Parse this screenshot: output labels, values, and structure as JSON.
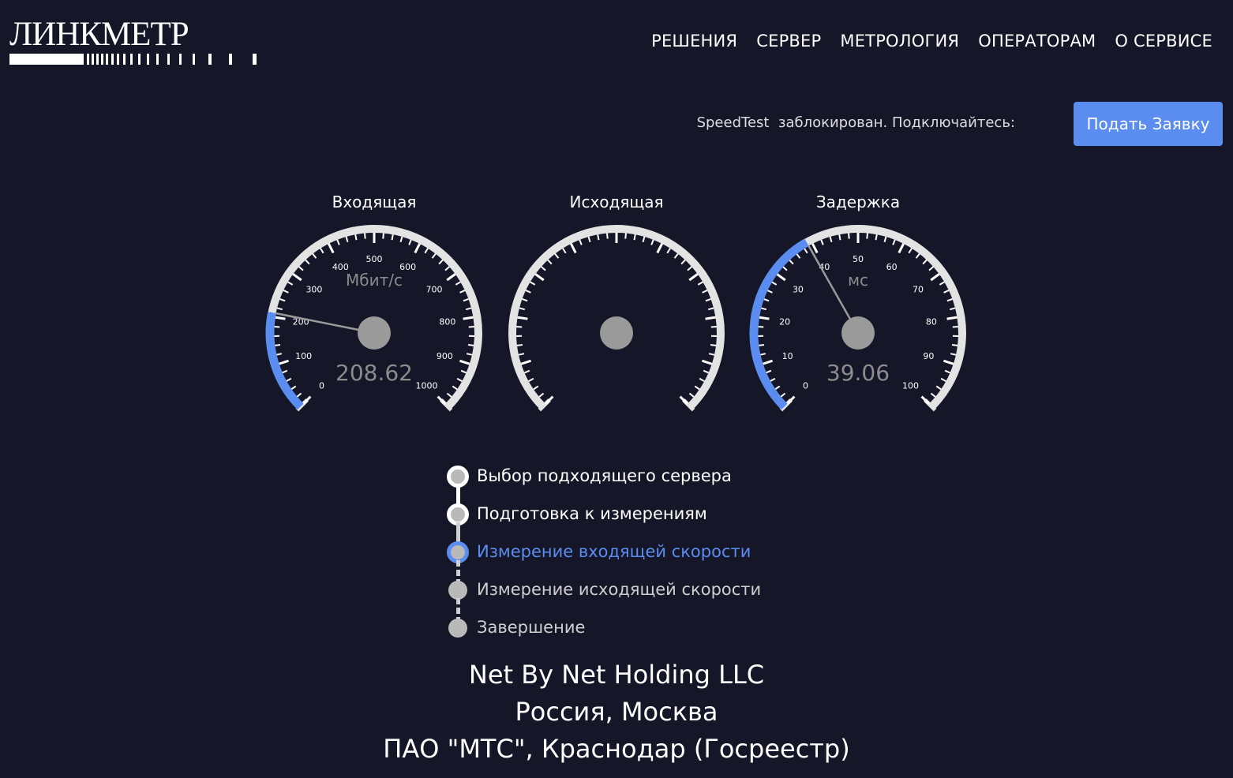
{
  "logo": {
    "text": "ЛИНКМЕТР"
  },
  "nav": {
    "items": [
      {
        "label": "РЕШЕНИЯ"
      },
      {
        "label": "СЕРВЕР"
      },
      {
        "label": "МЕТРОЛОГИЯ"
      },
      {
        "label": "ОПЕРАТОРАМ"
      },
      {
        "label": "О СЕРВИСЕ"
      }
    ]
  },
  "notice": {
    "text": "SpeedTest  заблокирован. Подключайтесь:",
    "button_label": "Подать Заявку"
  },
  "colors": {
    "accent": "#5b8cf0",
    "background": "#151627",
    "gauge_arc": "#e3e3e3",
    "hub": "#9a9a9a"
  },
  "gauges": [
    {
      "title": "Входящая",
      "unit": "Мбит/с",
      "value_text": "208.62",
      "value": 208.62,
      "min": 0,
      "max": 1000,
      "labels": [
        "0",
        "100",
        "200",
        "300",
        "400",
        "500",
        "600",
        "700",
        "800",
        "900",
        "1000"
      ]
    },
    {
      "title": "Исходящая",
      "unit": "",
      "value_text": "",
      "value": null,
      "min": 0,
      "max": 1000,
      "labels": []
    },
    {
      "title": "Задержка",
      "unit": "мс",
      "value_text": "39.06",
      "value": 39.06,
      "min": 0,
      "max": 100,
      "labels": [
        "0",
        "10",
        "20",
        "30",
        "40",
        "50",
        "60",
        "70",
        "80",
        "90",
        "100"
      ]
    }
  ],
  "steps": [
    {
      "label": "Выбор подходящего сервера",
      "state": "done"
    },
    {
      "label": "Подготовка к измерениям",
      "state": "done"
    },
    {
      "label": "Измерение входящей скорости",
      "state": "active"
    },
    {
      "label": "Измерение исходящей скорости",
      "state": "pending"
    },
    {
      "label": "Завершение",
      "state": "pending"
    }
  ],
  "server": {
    "provider": "Net By Net Holding LLC",
    "location": "Россия, Москва",
    "target": "ПАО \"МТС\", Краснодар (Госреестр)"
  }
}
